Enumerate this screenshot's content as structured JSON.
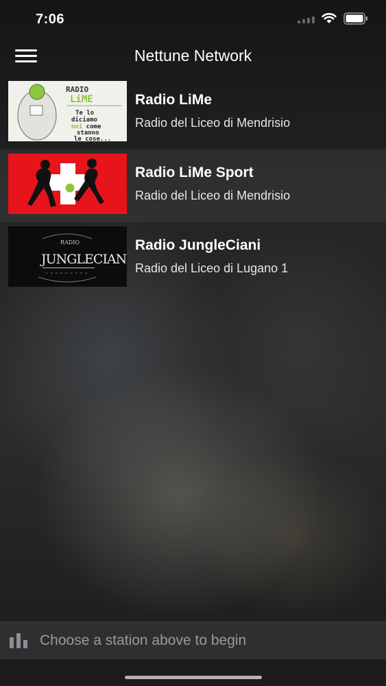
{
  "status_bar": {
    "time": "7:06"
  },
  "nav": {
    "title": "Nettune Network"
  },
  "stations": [
    {
      "name": "Radio LiMe",
      "description": "Radio del Liceo di Mendrisio",
      "logo_text": "RADIO LiME",
      "logo_tagline": "Te lo diciamo noi come stanno le cose..."
    },
    {
      "name": "Radio LiMe Sport",
      "description": "Radio del Liceo di Mendrisio"
    },
    {
      "name": "Radio JungleCiani",
      "description": "Radio del Liceo di Lugano 1",
      "logo_text": "JUNGLECIANI",
      "logo_small": "RADIO"
    }
  ],
  "player": {
    "status_text": "Choose a station above to begin"
  },
  "colors": {
    "accent_green": "#8cc63f",
    "sport_red": "#e8141c"
  }
}
